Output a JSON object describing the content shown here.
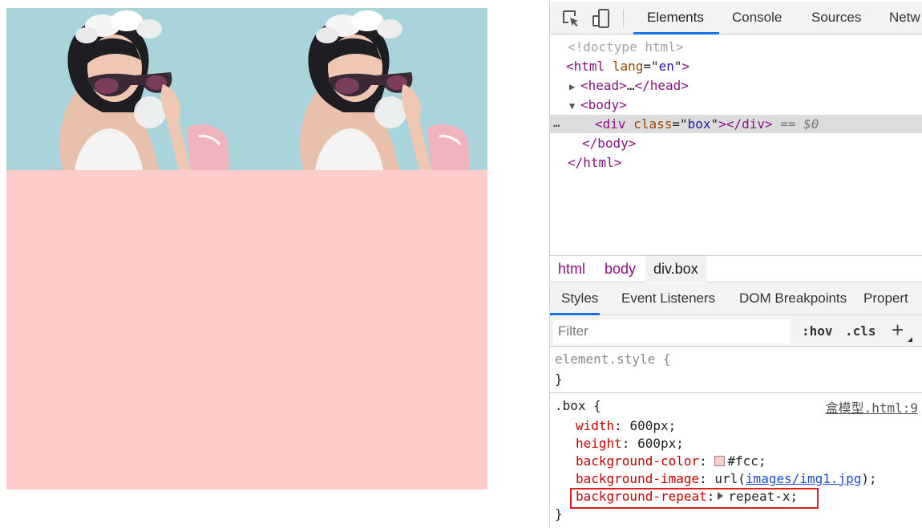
{
  "preview": {
    "box_color": "#fcc",
    "tiles": [
      {
        "alt": "background image tile",
        "icon": "woman-portrait-image"
      },
      {
        "alt": "background image tile",
        "icon": "woman-portrait-image"
      }
    ]
  },
  "devtools": {
    "tabs": [
      "Elements",
      "Console",
      "Sources",
      "Netw"
    ],
    "active_tab": "Elements",
    "icons": [
      "inspect-element-icon",
      "device-toggle-icon"
    ],
    "dom": {
      "doctype": "<!doctype html>",
      "html_open_tag": "html",
      "html_lang_attr": "lang",
      "html_lang_val": "en",
      "head_tag": "head",
      "head_ellipsis": "…",
      "body_tag": "body",
      "div_tag": "div",
      "div_class_attr": "class",
      "div_class_val": "box",
      "selected_marker": "== $0",
      "dots": "…",
      "body_close": "</body>",
      "html_close": "</html>"
    },
    "breadcrumbs": [
      "html",
      "body",
      "div.box"
    ],
    "styles_tabs": [
      "Styles",
      "Event Listeners",
      "DOM Breakpoints",
      "Propert"
    ],
    "filter": {
      "placeholder": "Filter",
      "hov": ":hov",
      "cls": ".cls",
      "plus": "+"
    },
    "rules": {
      "element_style_selector": "element.style {",
      "close_brace": "}",
      "box_selector": ".box {",
      "source": "盒模型.html:9",
      "declarations": [
        {
          "prop": "width",
          "value": "600px;"
        },
        {
          "prop": "height",
          "value": "600px;"
        },
        {
          "prop": "background-color",
          "value": "#fcc;"
        },
        {
          "prop": "background-image",
          "value_prefix": "url(",
          "link": "images/img1.jpg",
          "value_suffix": ");"
        },
        {
          "prop": "background-repeat",
          "value": "repeat-x;"
        }
      ]
    },
    "colors": {
      "accent": "#1a73e8",
      "highlight_border": "#e02020",
      "tag": "#881280",
      "prop": "#c80000"
    }
  }
}
